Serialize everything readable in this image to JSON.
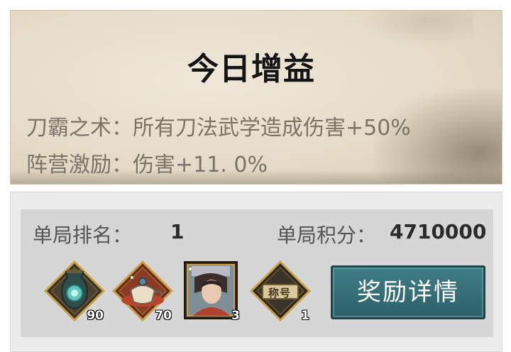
{
  "buff": {
    "title": "今日增益",
    "line1": "刀霸之术：所有刀法武学造成伤害+50%",
    "line2": "阵营激励：伤害+11. 0%"
  },
  "result": {
    "rank_label": "单局排名：",
    "rank_value": "1",
    "score_label": "单局积分：",
    "score_value": "4710000"
  },
  "rewards": [
    {
      "icon": "jade-vase-icon",
      "count": "90"
    },
    {
      "icon": "teapot-icon",
      "count": "70"
    },
    {
      "icon": "character-portrait-card",
      "count": "3"
    },
    {
      "icon": "title-badge-icon",
      "label": "称号",
      "count": "1"
    }
  ],
  "detail_button": "奖励详情",
  "colors": {
    "button_teal": "#2d6068",
    "frame_gold": "#c9a24a",
    "paper": "#e6dcc9"
  }
}
